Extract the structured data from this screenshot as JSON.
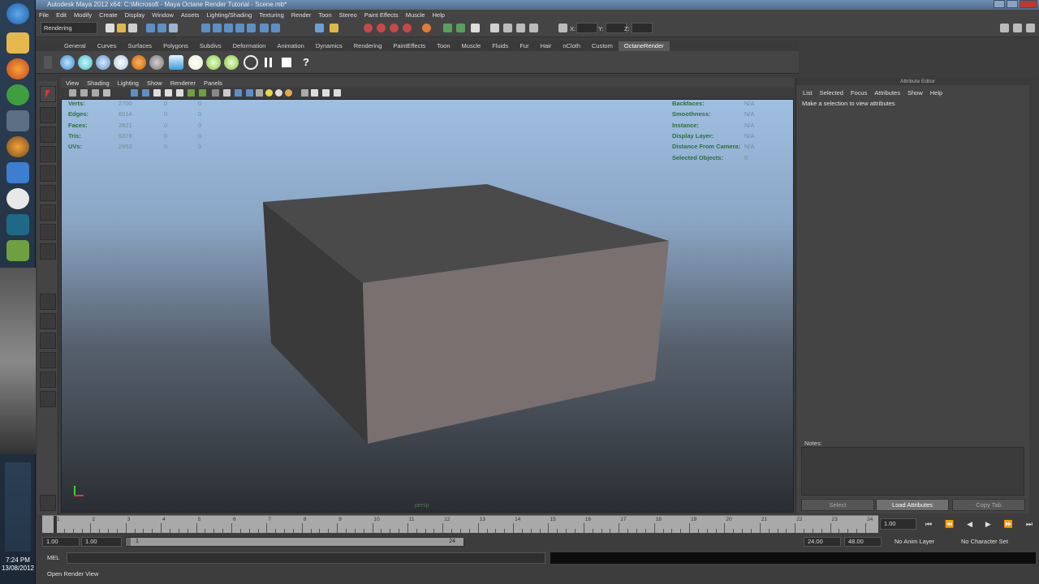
{
  "window": {
    "title": "Autodesk Maya 2012 x64: C:\\Microsoft - Maya Octane Render Tutorial - Scene.mb*"
  },
  "menubar": [
    "File",
    "Edit",
    "Modify",
    "Create",
    "Display",
    "Window",
    "Assets",
    "Lighting/Shading",
    "Texturing",
    "Render",
    "Toon",
    "Stereo",
    "Paint Effects",
    "Muscle",
    "Help"
  ],
  "statusline": {
    "mode": "Rendering",
    "x_label": "X:",
    "y_label": "Y:",
    "z_label": "Z:"
  },
  "shelf_tabs": [
    "General",
    "Curves",
    "Surfaces",
    "Polygons",
    "Subdivs",
    "Deformation",
    "Animation",
    "Dynamics",
    "Rendering",
    "PaintEffects",
    "Toon",
    "Muscle",
    "Fluids",
    "Fur",
    "Hair",
    "nCloth",
    "Custom",
    "OctaneRender"
  ],
  "shelf_active": "OctaneRender",
  "viewport": {
    "menu": [
      "View",
      "Shading",
      "Lighting",
      "Show",
      "Renderer",
      "Panels"
    ],
    "camera_label": "persp",
    "hud_left": [
      {
        "label": "Verts:",
        "v1": "2700",
        "v2": "0",
        "v3": "0"
      },
      {
        "label": "Edges:",
        "v1": "6014",
        "v2": "0",
        "v3": "0"
      },
      {
        "label": "Faces:",
        "v1": "2821",
        "v2": "0",
        "v3": "0"
      },
      {
        "label": "Tris:",
        "v1": "5378",
        "v2": "0",
        "v3": "0"
      },
      {
        "label": "UVs:",
        "v1": "2953",
        "v2": "0",
        "v3": "0"
      }
    ],
    "hud_right": [
      {
        "label": "Backfaces:",
        "value": "N/A"
      },
      {
        "label": "Smoothness:",
        "value": "N/A"
      },
      {
        "label": "Instance:",
        "value": "N/A"
      },
      {
        "label": "Display Layer:",
        "value": "N/A"
      },
      {
        "label": "Distance From Camera:",
        "value": "N/A"
      },
      {
        "label": "Selected Objects:",
        "value": "0"
      }
    ]
  },
  "attribute_editor": {
    "title": "Attribute Editor",
    "menu": [
      "List",
      "Selected",
      "Focus",
      "Attributes",
      "Show",
      "Help"
    ],
    "message": "Make a selection to view attributes",
    "notes_label": "Notes:",
    "buttons": {
      "select": "Select",
      "load": "Load Attributes",
      "copy": "Copy Tab"
    }
  },
  "timeslider": {
    "ticks": [
      "1",
      "2",
      "3",
      "4",
      "5",
      "6",
      "7",
      "8",
      "9",
      "10",
      "11",
      "12",
      "13",
      "14",
      "15",
      "16",
      "17",
      "18",
      "19",
      "20",
      "21",
      "22",
      "23",
      "24"
    ],
    "current_frame": "1.00"
  },
  "range": {
    "start_time": "1.00",
    "playback_start": "1.00",
    "slider_start_label": "1",
    "slider_end_label": "24",
    "playback_end": "24.00",
    "end_time": "48.00",
    "anim_layer": "No Anim Layer",
    "character_set": "No Character Set"
  },
  "cmdline": {
    "label": "MEL"
  },
  "helpline": {
    "text": "Open Render View"
  },
  "taskbar": {
    "time": "7:24 PM",
    "date": "13/08/2012"
  },
  "colors": {
    "accent": "#5a5a5a",
    "hud": "#2f6d3a",
    "sky_top": "#9fbfe2"
  }
}
